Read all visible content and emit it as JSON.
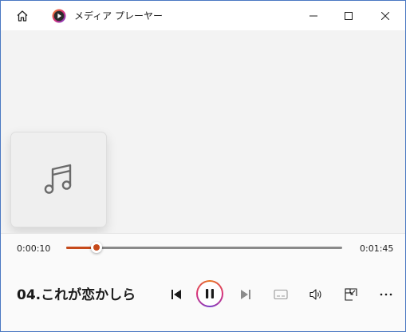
{
  "window": {
    "title": "メディア プレーヤー",
    "icons": {
      "home": "home-icon",
      "logo": "media-player-logo",
      "minimize": "minimize-icon",
      "maximize": "maximize-icon",
      "close": "close-icon"
    }
  },
  "album_art": {
    "icon": "music-note-icon"
  },
  "playback": {
    "elapsed": "0:00:10",
    "total": "0:01:45",
    "progress_fraction": 0.11,
    "accent_color": "#c64a1b"
  },
  "track": {
    "title": "04.これが恋かしら"
  },
  "controls": {
    "icons": [
      "previous-icon",
      "pause-icon",
      "next-icon",
      "subtitles-icon",
      "volume-icon",
      "mini-player-icon",
      "more-icon"
    ]
  }
}
